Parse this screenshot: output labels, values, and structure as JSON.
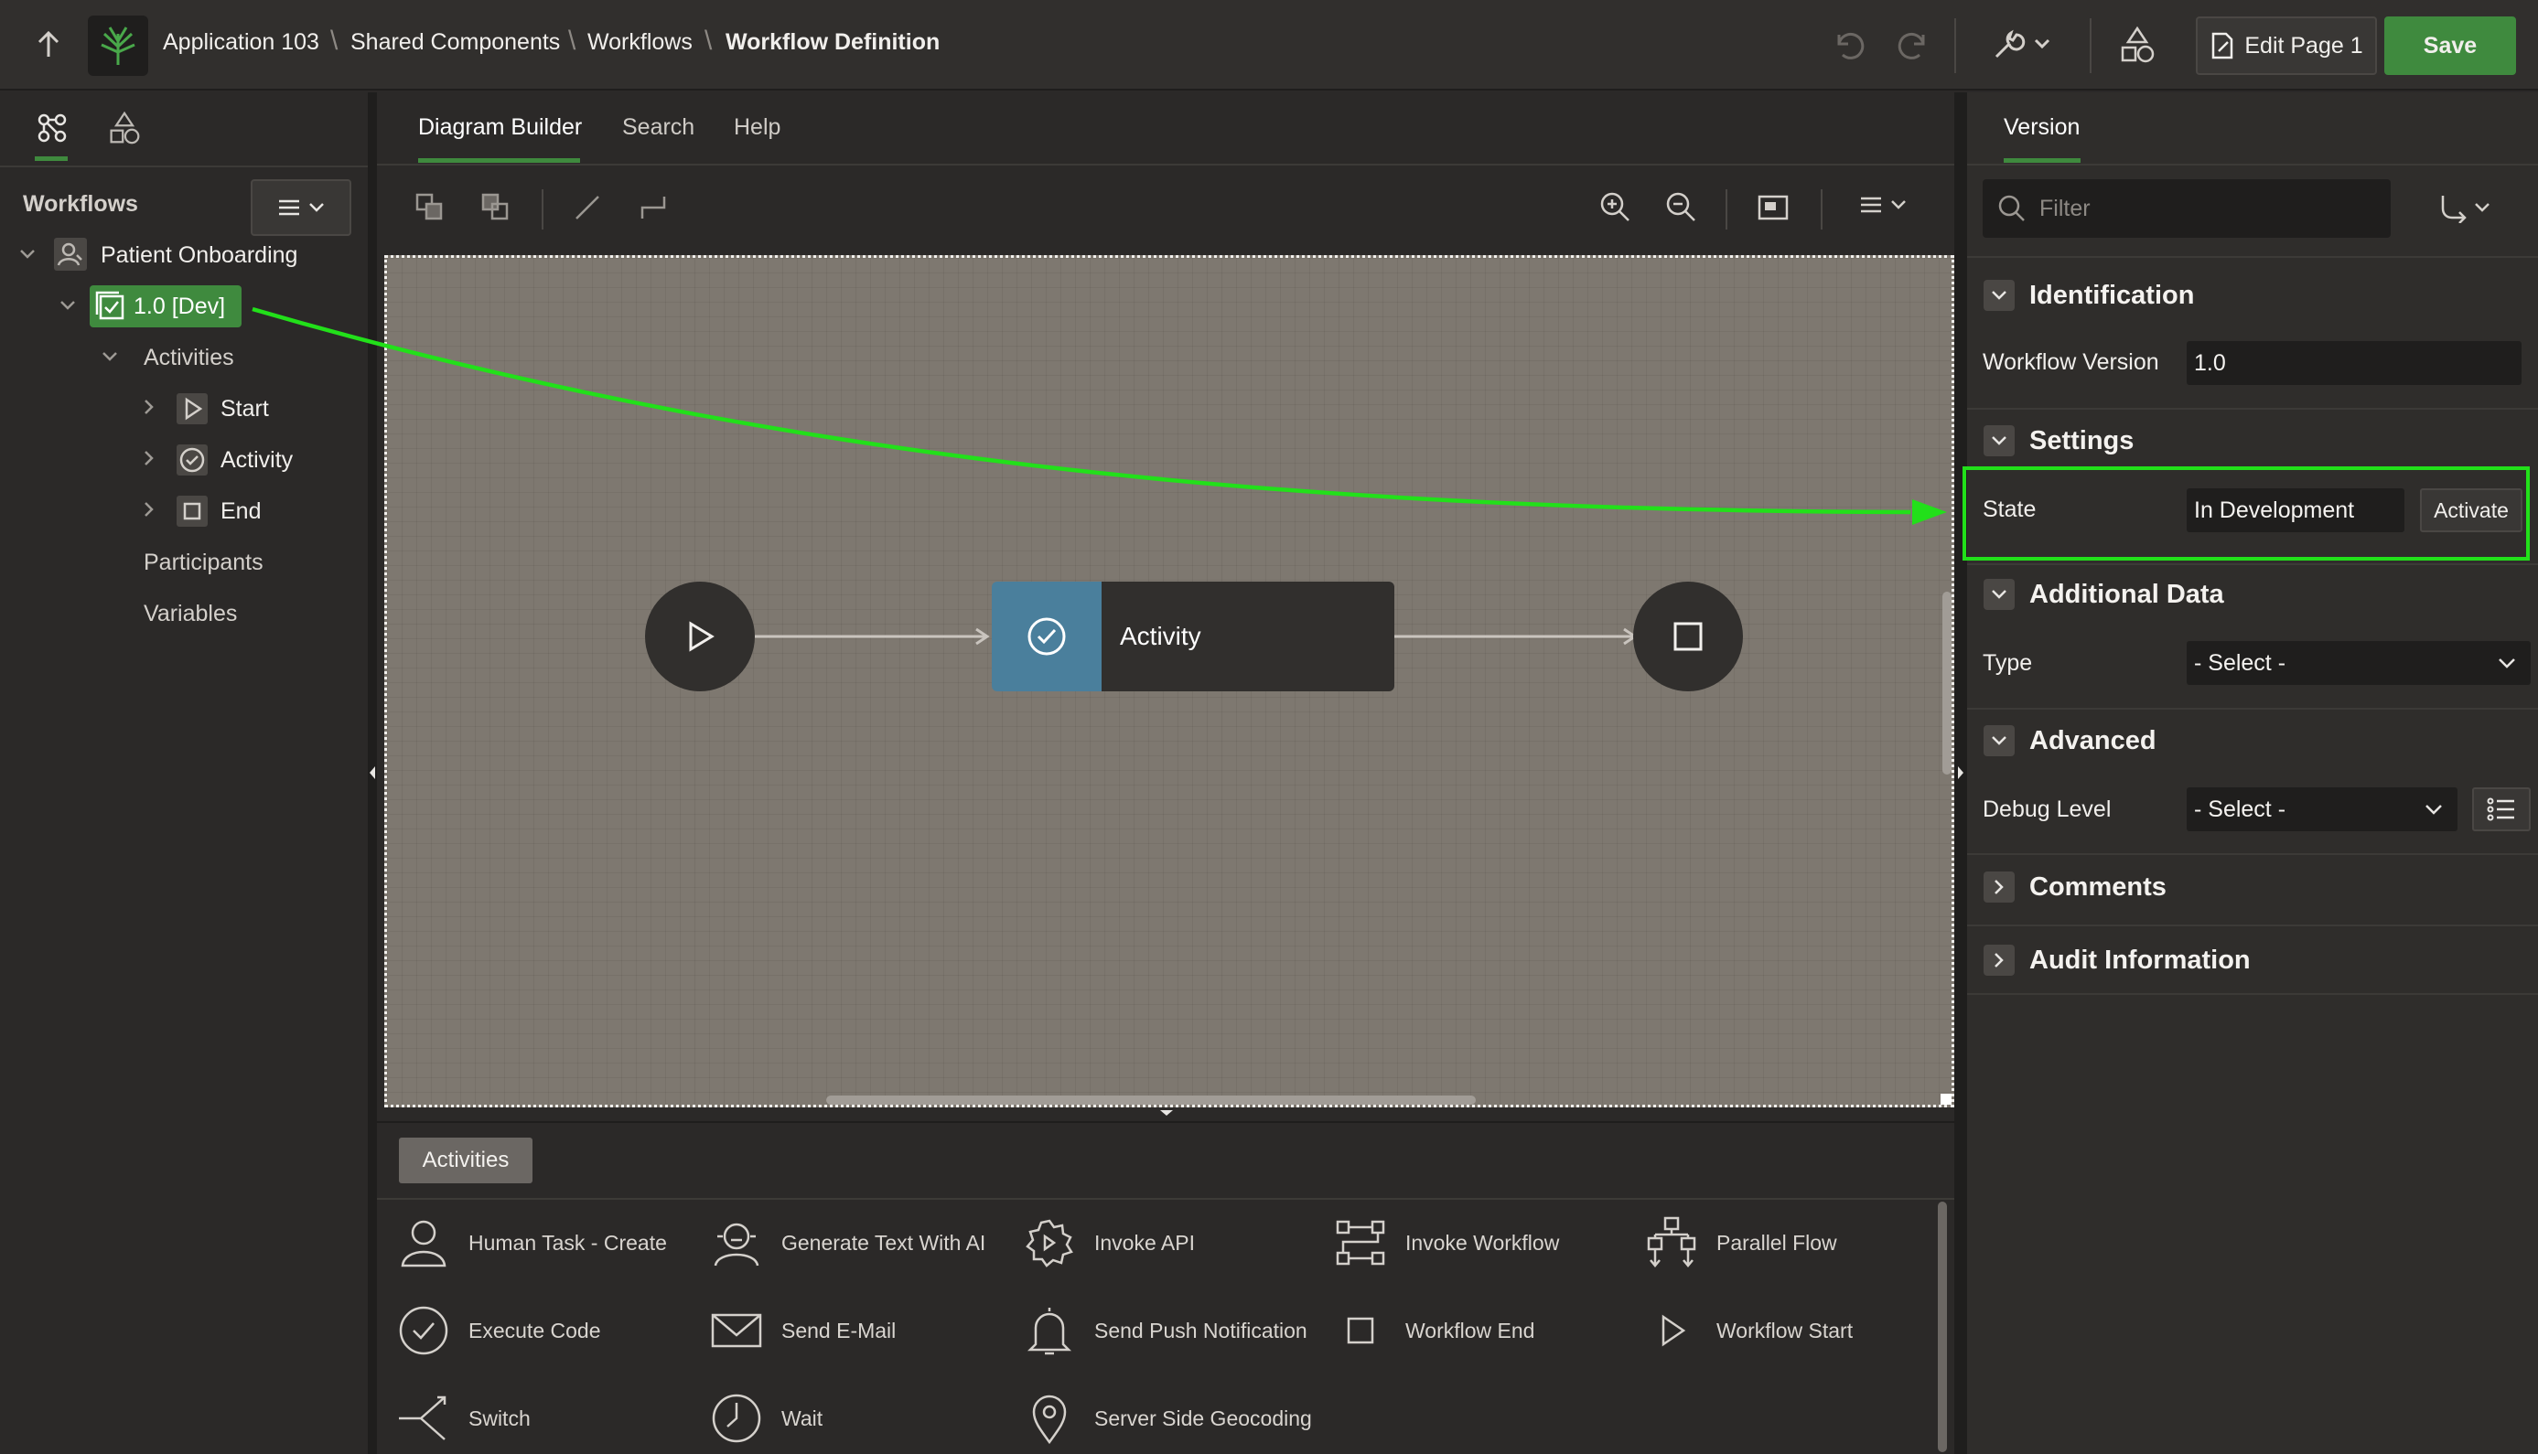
{
  "header": {
    "breadcrumbs": [
      "Application 103",
      "Shared Components",
      "Workflows",
      "Workflow Definition"
    ],
    "edit_page_label": "Edit Page 1",
    "save_label": "Save"
  },
  "left": {
    "section_title": "Workflows",
    "tree": {
      "workflow": "Patient Onboarding",
      "version": "1.0 [Dev]",
      "activities_label": "Activities",
      "activities": [
        "Start",
        "Activity",
        "End"
      ],
      "participants_label": "Participants",
      "variables_label": "Variables"
    }
  },
  "center": {
    "tabs": [
      "Diagram Builder",
      "Search",
      "Help"
    ],
    "diagram": {
      "activity_label": "Activity"
    },
    "palette": {
      "tab_label": "Activities",
      "items": [
        "Human Task - Create",
        "Generate Text With AI",
        "Invoke API",
        "Invoke Workflow",
        "Parallel Flow",
        "Execute Code",
        "Send E-Mail",
        "Send Push Notification",
        "Workflow End",
        "Workflow Start",
        "Switch",
        "Wait",
        "Server Side Geocoding"
      ]
    }
  },
  "right": {
    "tab": "Version",
    "filter_placeholder": "Filter",
    "sections": {
      "identification": "Identification",
      "settings": "Settings",
      "additional_data": "Additional Data",
      "advanced": "Advanced",
      "comments": "Comments",
      "audit": "Audit Information"
    },
    "props": {
      "workflow_version_label": "Workflow Version",
      "workflow_version_value": "1.0",
      "state_label": "State",
      "state_value": "In Development",
      "activate_label": "Activate",
      "type_label": "Type",
      "type_value": "- Select -",
      "debug_level_label": "Debug Level",
      "debug_level_value": "- Select -"
    }
  },
  "colors": {
    "accent_green": "#3f8a3e",
    "annotation_green": "#22e01a",
    "activity_blue": "#4a7f9c",
    "canvas": "#7e7870"
  }
}
